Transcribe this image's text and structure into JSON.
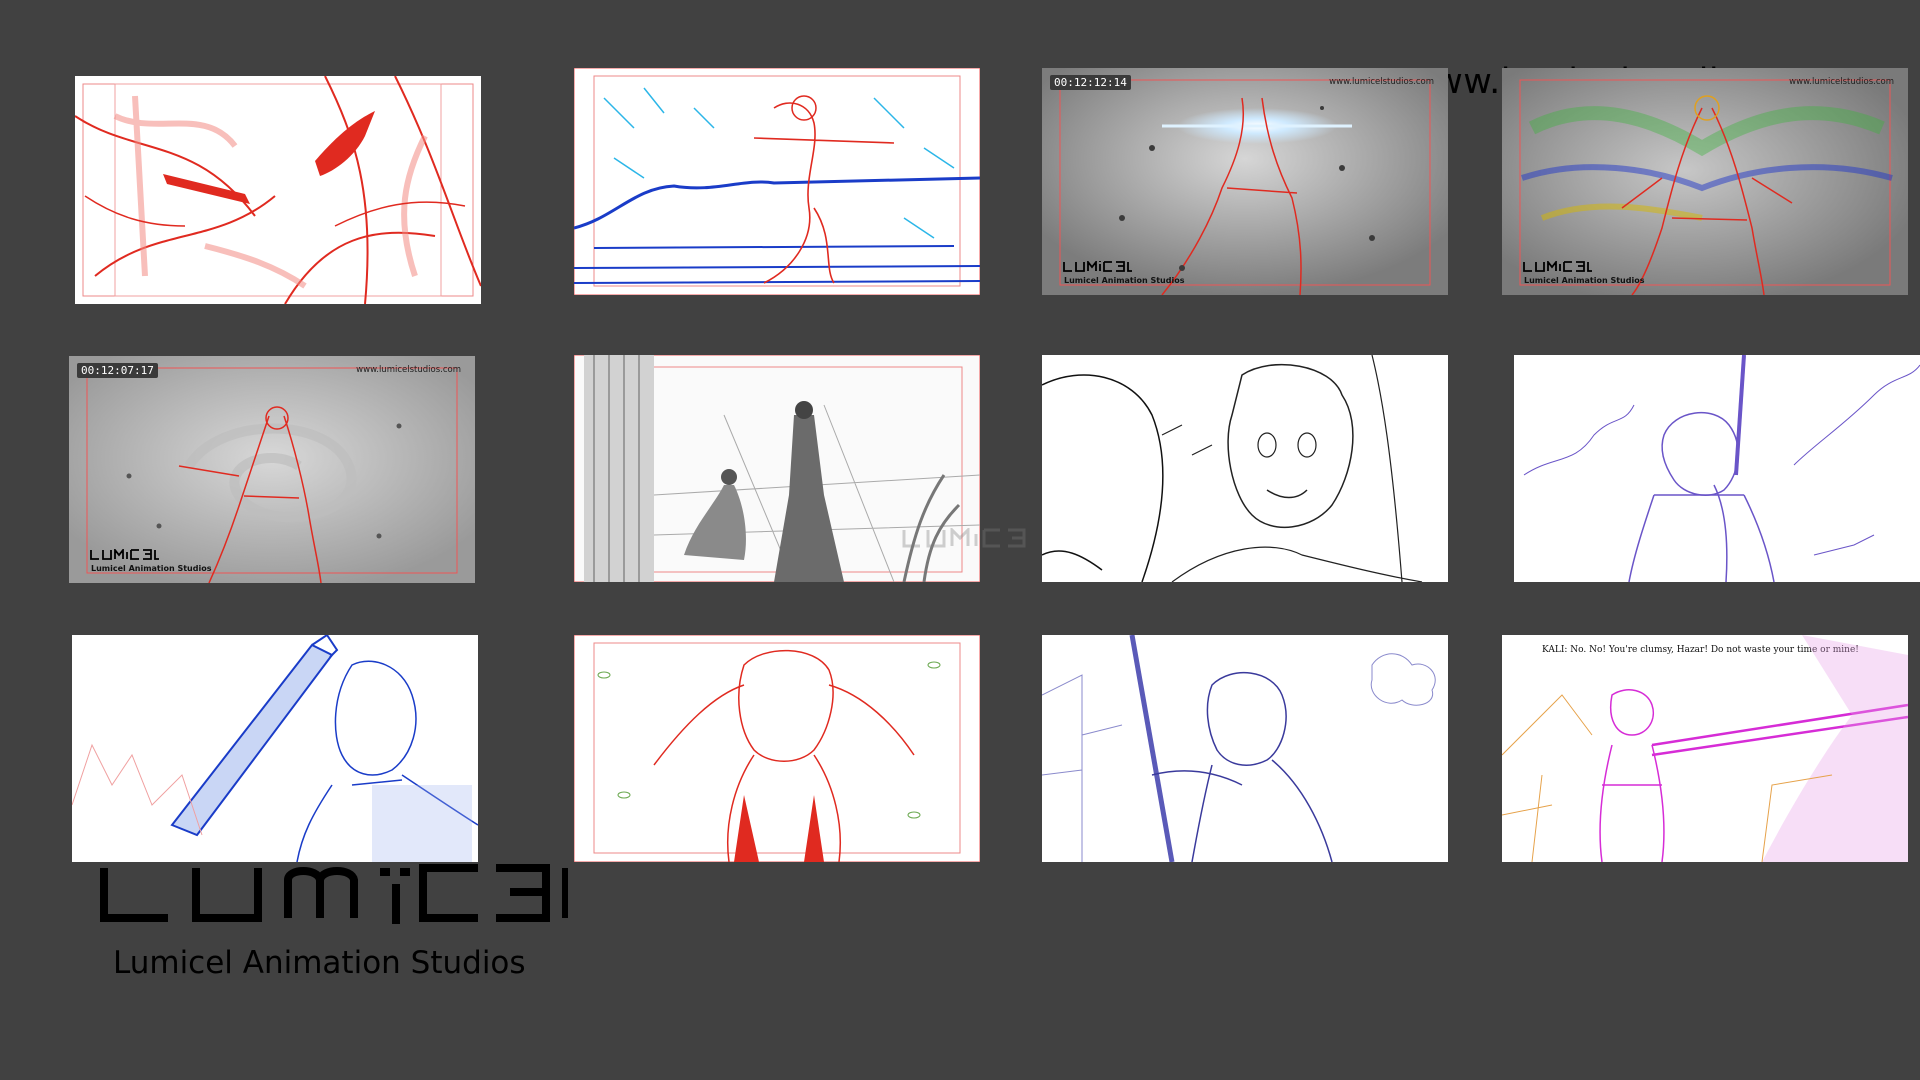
{
  "header": {
    "url": "www.lumicelstudios.com"
  },
  "brand": {
    "logo_text": "LUMICEL",
    "studio_name": "Lumicel Animation Studios",
    "accent": "#e8261c"
  },
  "panels": [
    {
      "id": 1,
      "style": "red-sketch-eyes"
    },
    {
      "id": 2,
      "style": "blue-red-sword-run"
    },
    {
      "id": 3,
      "style": "gray-glow-praying",
      "timestamp": "00:12:12:14",
      "site": "www.lumicelstudios.com",
      "studio": "Lumicel Animation Studios"
    },
    {
      "id": 4,
      "style": "color-aura",
      "site": "www.lumicelstudios.com",
      "studio": "Lumicel Animation Studios"
    },
    {
      "id": 5,
      "style": "gray-swirl",
      "timestamp": "00:12:07:17",
      "site": "www.lumicelstudios.com",
      "studio": "Lumicel Animation Studios"
    },
    {
      "id": 6,
      "style": "gray-throne-room"
    },
    {
      "id": 7,
      "style": "black-lineart-face"
    },
    {
      "id": 8,
      "style": "purple-sword-raise"
    },
    {
      "id": 9,
      "style": "blue-sword-overhead"
    },
    {
      "id": 10,
      "style": "red-head-clutch"
    },
    {
      "id": 11,
      "style": "purple-staff-grip"
    },
    {
      "id": 12,
      "style": "magenta-sword-strike",
      "dialogue": "KALI:  No. No! You're clumsy, Hazar! Do not waste your time or mine!"
    }
  ]
}
